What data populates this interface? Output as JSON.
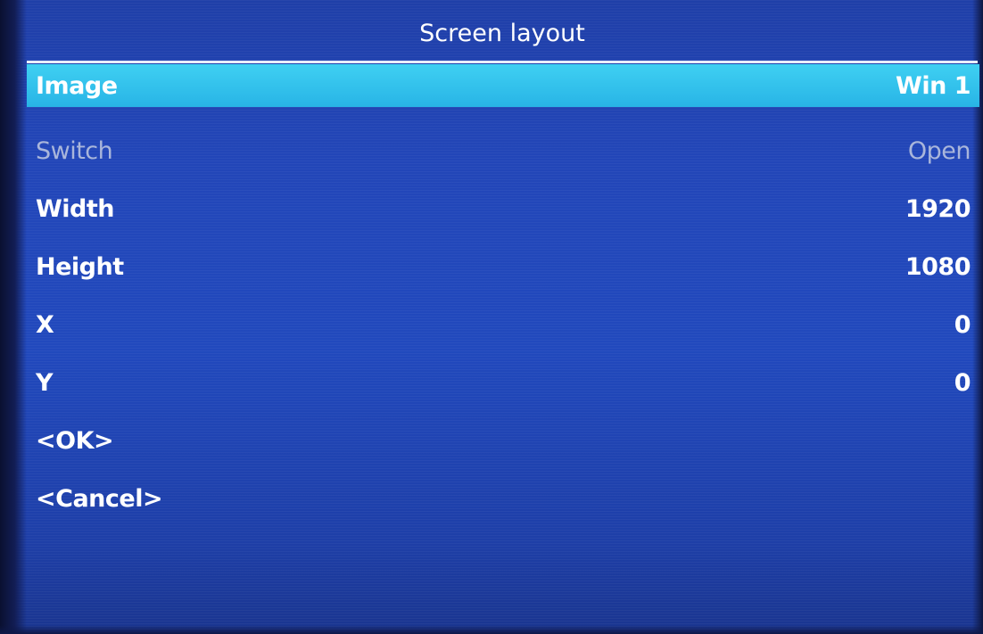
{
  "title": "Screen layout",
  "menu": {
    "items": [
      {
        "label": "Image",
        "value": "Win 1"
      },
      {
        "label": "Switch",
        "value": "Open"
      },
      {
        "label": "Width",
        "value": "1920"
      },
      {
        "label": "Height",
        "value": "1080"
      },
      {
        "label": "X",
        "value": "0"
      },
      {
        "label": "Y",
        "value": "0"
      },
      {
        "label": "<OK>"
      },
      {
        "label": "<Cancel>"
      }
    ]
  },
  "colors": {
    "background": "#2246b8",
    "highlight": "#32c2ec",
    "text": "#ffffff",
    "disabled_text": "#a9b6db"
  }
}
